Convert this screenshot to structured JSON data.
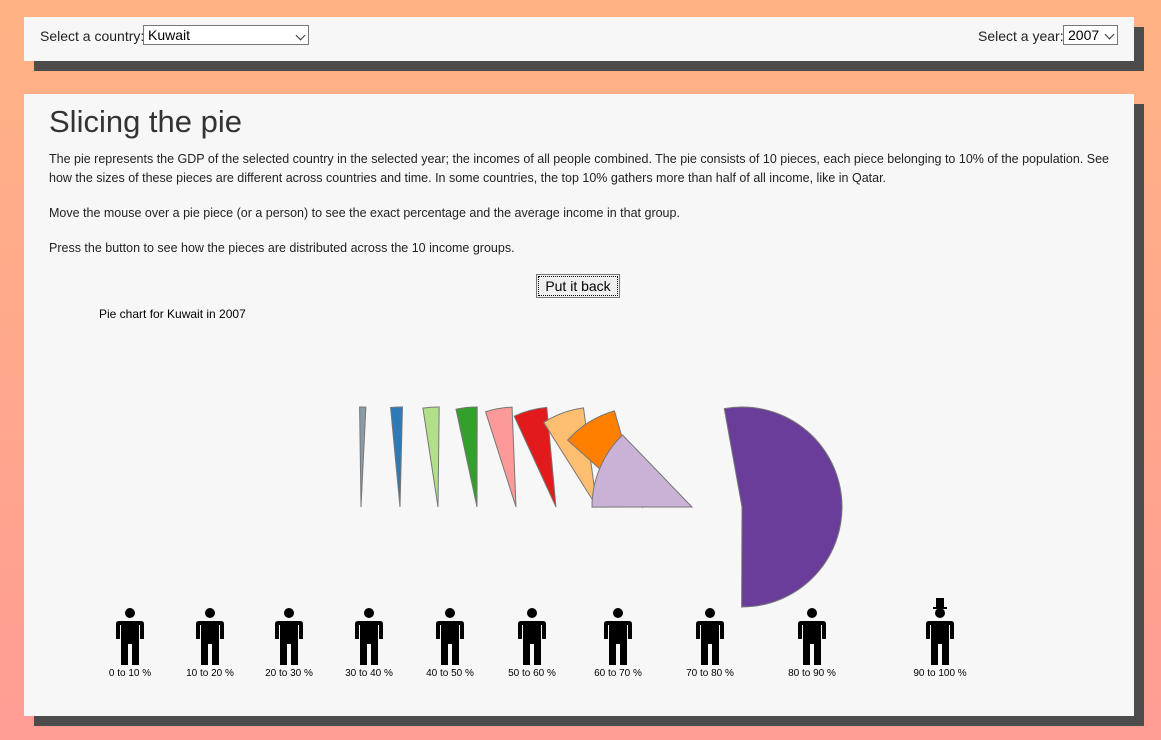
{
  "country_control": {
    "label": "Select a country:",
    "selected": "Kuwait"
  },
  "year_control": {
    "label": "Select a year:",
    "selected": "2007"
  },
  "main": {
    "title": "Slicing the pie",
    "paragraphs": [
      "The pie represents the GDP of the selected country in the selected year; the incomes of all people combined. The pie consists of 10 pieces, each piece belonging to 10% of the population. See how the sizes of these pieces are different across countries and time. In some countries, the top 10% gathers more than half of all income, like in Qatar.",
      "Move the mouse over a pie piece (or a person) to see the exact percentage and the average income in that group.",
      "Press the button to see how the pieces are distributed across the 10 income groups."
    ],
    "button_label": "Put it back",
    "chart_title": "Pie chart for Kuwait in 2007"
  },
  "chart_data": {
    "type": "pie",
    "title": "Pie chart for Kuwait in 2007",
    "categories": [
      "0 to 10 %",
      "10 to 20 %",
      "20 to 30 %",
      "30 to 40 %",
      "40 to 50 %",
      "50 to 60 %",
      "60 to 70 %",
      "70 to 80 %",
      "80 to 90 %",
      "90 to 100 %"
    ],
    "values": [
      1.0,
      1.9,
      2.6,
      3.4,
      4.3,
      5.4,
      6.8,
      8.9,
      12.8,
      52.9
    ],
    "colors": [
      "#8c9ba6",
      "#2c7bb6",
      "#b2df8a",
      "#33a02c",
      "#fb9a99",
      "#e31a1c",
      "#fdbf6f",
      "#ff7f00",
      "#cab2d6",
      "#6a3d9a"
    ],
    "state": "exploded",
    "top_group_icon": "top-hat-icon"
  }
}
